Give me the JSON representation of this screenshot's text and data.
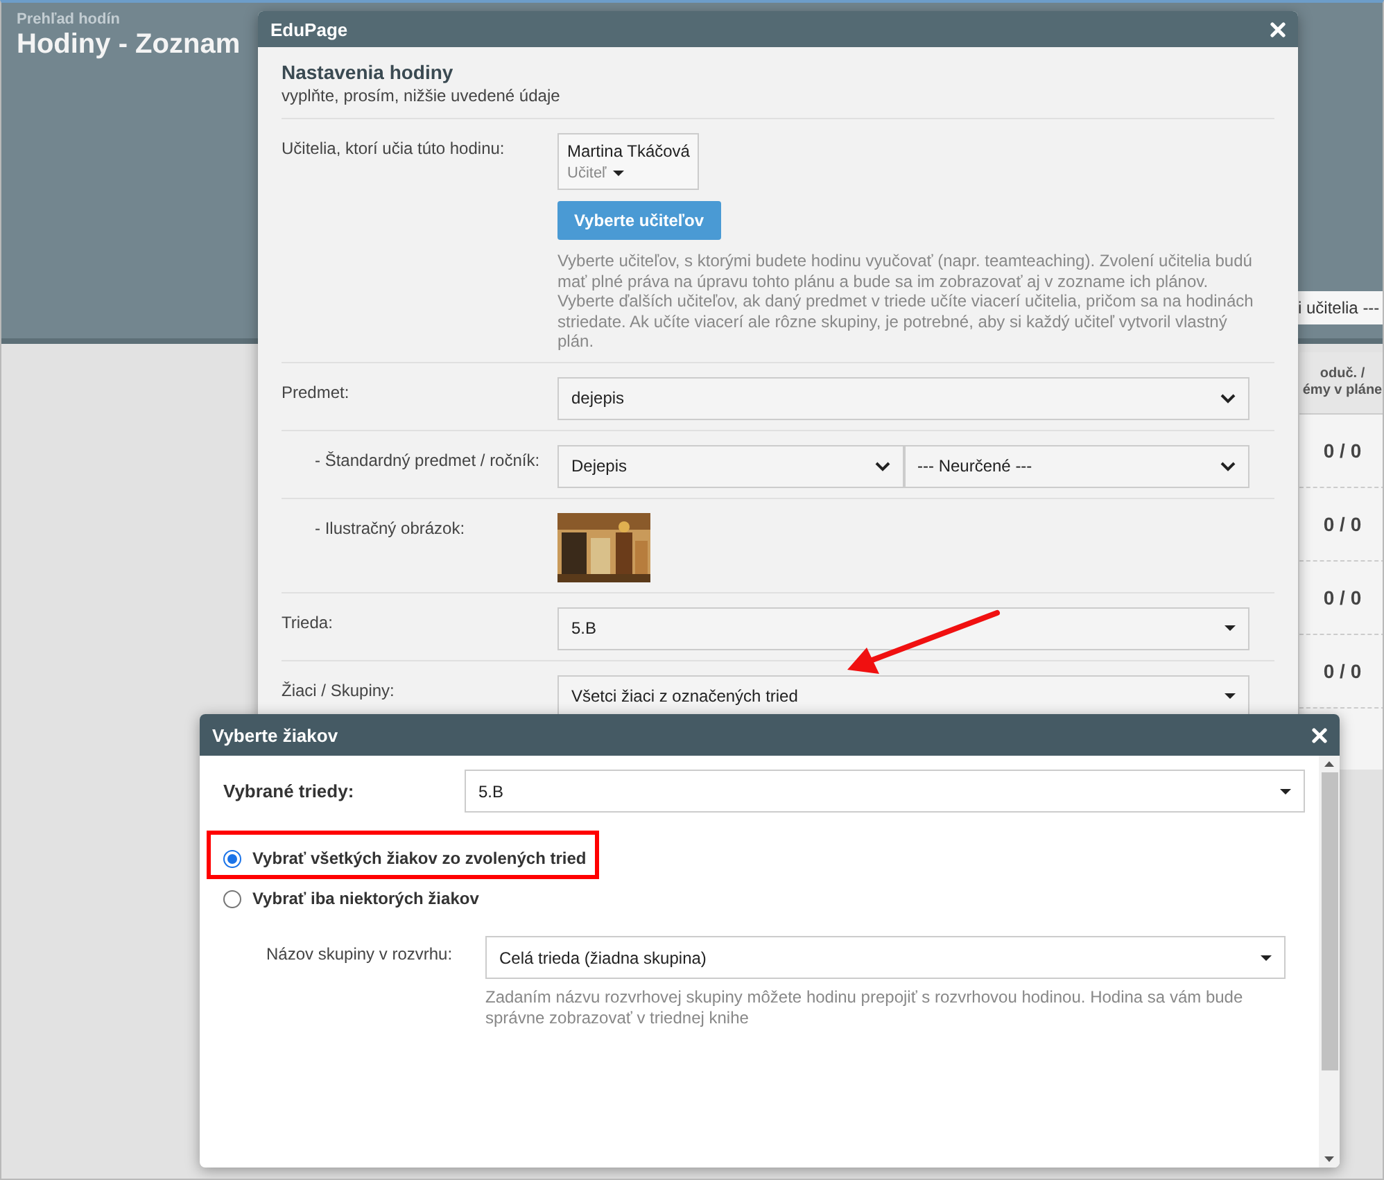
{
  "page": {
    "subtitle": "Prehľad hodín",
    "title": "Hodiny - Zoznam",
    "filter_text": "i učitelia ---",
    "table": {
      "header": [
        "oduč. /",
        "émy v pláne"
      ],
      "rows": [
        "0 / 0",
        "0 / 0",
        "0 / 0",
        "0 / 0"
      ]
    }
  },
  "lesson_dialog": {
    "title": "EduPage",
    "heading": "Nastavenia hodiny",
    "subheading": "vyplňte, prosím, nižšie uvedené údaje",
    "teachers": {
      "label": "Učitelia, ktorí učia túto hodinu:",
      "name": "Martina Tkáčová",
      "role": "Učiteľ",
      "button": "Vyberte učiteľov",
      "help": "Vyberte učiteľov, s ktorými budete hodinu vyučovať (napr. teamteaching). Zvolení učitelia budú mať plné práva na úpravu tohto plánu a bude sa im zobrazovať aj v zozname ich plánov. Vyberte ďalších učiteľov, ak daný predmet v triede učíte viacerí učitelia, pričom sa na hodinách striedate. Ak učíte viacerí ale rôzne skupiny, je potrebné, aby si každý učiteľ vytvoril vlastný plán."
    },
    "fields": [
      {
        "kind": "select",
        "label": "Predmet:",
        "values": [
          "dejepis"
        ],
        "children": [
          {
            "kind": "select",
            "label": "- Štandardný predmet / ročník:",
            "values": [
              "Dejepis",
              "--- Neurčené ---"
            ]
          },
          {
            "kind": "picture",
            "label": "- Ilustračný obrázok:"
          }
        ]
      },
      {
        "kind": "combo",
        "label": "Trieda:",
        "values": [
          "5.B"
        ]
      },
      {
        "kind": "combo",
        "label": "Žiaci / Skupiny:",
        "values": [
          "Všetci žiaci z označených tried"
        ]
      }
    ]
  },
  "students_dialog": {
    "title": "Vyberte žiakov",
    "classes_label": "Vybrané triedy:",
    "classes_value": "5.B",
    "options": [
      {
        "label": "Vybrať všetkých žiakov zo zvolených tried",
        "selected": true
      },
      {
        "label": "Vybrať iba niektorých žiakov",
        "selected": false
      }
    ],
    "group_label": "Názov skupiny v rozvrhu:",
    "group_value": "Celá trieda (žiadna skupina)",
    "group_help": "Zadaním názvu rozvrhovej skupiny môžete hodinu prepojiť s rozvrhovou hodinou. Hodina sa vám bude správne zobrazovať v triednej knihe"
  }
}
